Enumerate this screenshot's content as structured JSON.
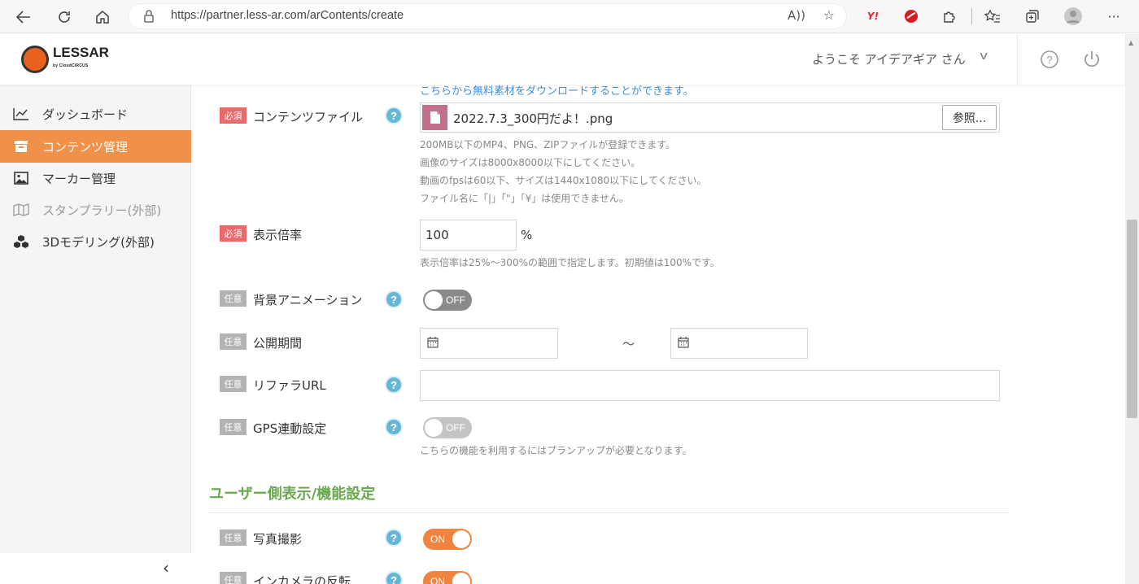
{
  "browser": {
    "url": "https://partner.less-ar.com/arContents/create",
    "read_aloud": "A))",
    "ext_yahoo": "Y!"
  },
  "header": {
    "logo_text": "LESSAR",
    "logo_sub": "by CloudCIRCUS",
    "welcome": "ようこそ アイデアギア さん",
    "chevron": "∨"
  },
  "sidebar": {
    "items": [
      {
        "label": "ダッシュボード",
        "icon": "chart-line-icon"
      },
      {
        "label": "コンテンツ管理",
        "icon": "archive-box-icon"
      },
      {
        "label": "マーカー管理",
        "icon": "image-icon"
      },
      {
        "label": "スタンプラリー(外部)",
        "icon": "map-icon"
      },
      {
        "label": "3Dモデリング(外部)",
        "icon": "cubes-icon"
      }
    ],
    "collapse_glyph": "‹"
  },
  "form": {
    "badge_required": "必須",
    "badge_optional": "任意",
    "help_glyph": "?",
    "free_material_link": "こちらから無料素材をダウンロードすることができます。",
    "content_file": {
      "label": "コンテンツファイル",
      "file_name": "2022.7.3_300円だよ！.png",
      "browse_label": "参照...",
      "hints": [
        "200MB以下のMP4、PNG、ZIPファイルが登録できます。",
        "画像のサイズは8000x8000以下にしてください。",
        "動画のfpsは60以下、サイズは1440x1080以下にしてください。",
        "ファイル名に「|」「\"」「¥」は使用できません。"
      ]
    },
    "display_scale": {
      "label": "表示倍率",
      "value": "100",
      "unit": "%",
      "hint": "表示倍率は25%〜300%の範囲で指定します。初期値は100%です。"
    },
    "bg_animation": {
      "label": "背景アニメーション",
      "toggle": "OFF"
    },
    "publish_period": {
      "label": "公開期間",
      "separator": "〜"
    },
    "referrer_url": {
      "label": "リファラURL",
      "value": ""
    },
    "gps": {
      "label": "GPS連動設定",
      "toggle": "OFF",
      "hint": "こちらの機能を利用するにはプランアップが必要となります。"
    },
    "user_section_title": "ユーザー側表示/機能設定",
    "photo": {
      "label": "写真撮影",
      "toggle": "ON"
    },
    "in_camera": {
      "label": "インカメラの反転",
      "toggle": "ON"
    }
  },
  "colors": {
    "accent_orange": "#f19048",
    "toggle_on": "#f0843e",
    "required_red": "#e96a6a",
    "help_blue": "#67b6d6",
    "section_green": "#6aa84f",
    "link_blue": "#3d8fd6"
  }
}
